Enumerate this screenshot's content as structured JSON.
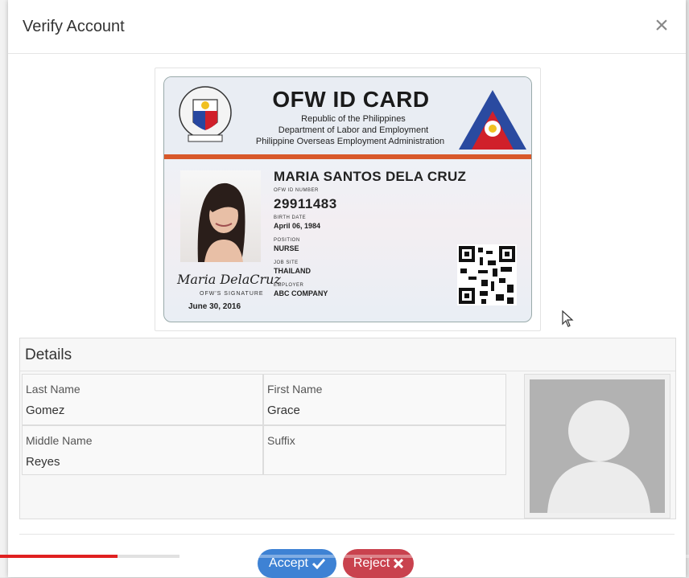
{
  "modal": {
    "title": "Verify Account",
    "close_symbol": "×"
  },
  "id_card": {
    "title": "OFW ID CARD",
    "line1": "Republic of the Philippines",
    "line2": "Department of Labor and Employment",
    "line3": "Philippine Overseas Employment Administration",
    "name": "MARIA SANTOS DELA CRUZ",
    "id_label": "OFW ID NUMBER",
    "id_number": "29911483",
    "birth_label": "BIRTH DATE",
    "birth_date": "April 06, 1984",
    "position_label": "POSITION",
    "position": "NURSE",
    "jobsite_label": "JOB SITE",
    "jobsite": "THAILAND",
    "employer_label": "EMPLOYER",
    "employer": "ABC COMPANY",
    "signature": "Maria DelaCruz",
    "signature_label": "OFW'S SIGNATURE",
    "expiry": "June 30, 2016"
  },
  "details": {
    "title": "Details",
    "fields": [
      {
        "label": "Last Name",
        "value": "Gomez"
      },
      {
        "label": "First Name",
        "value": "Grace"
      },
      {
        "label": "Middle Name",
        "value": "Reyes"
      },
      {
        "label": "Suffix",
        "value": ""
      }
    ]
  },
  "actions": {
    "accept_label": "Accept",
    "reject_label": "Reject"
  },
  "colors": {
    "accept": "#3e82d4",
    "reject": "#c9424e",
    "progress": "#e02020"
  },
  "video_progress": {
    "played": 0.17,
    "buffered": 0.26
  }
}
